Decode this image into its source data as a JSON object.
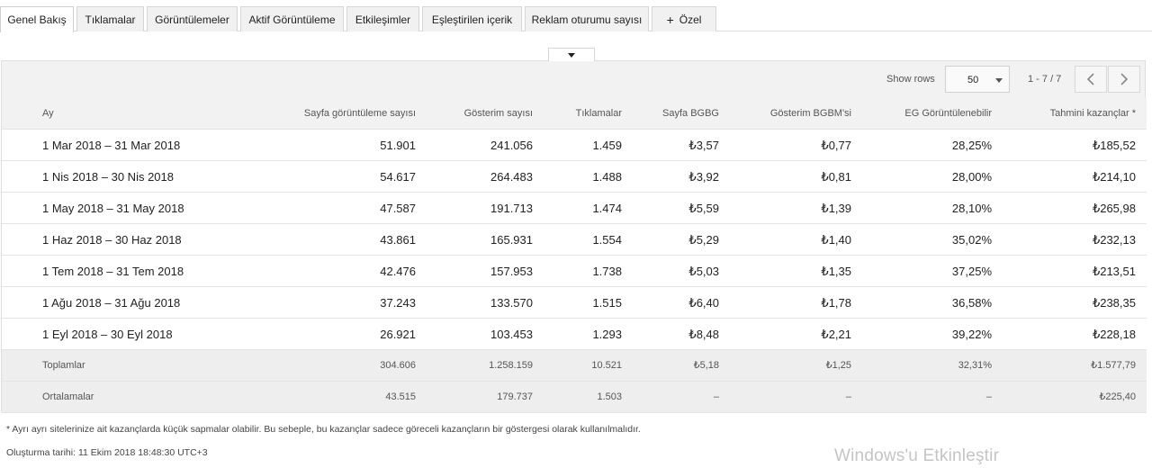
{
  "tabs": [
    {
      "label": "Genel Bakış",
      "active": true
    },
    {
      "label": "Tıklamalar"
    },
    {
      "label": "Görüntülemeler"
    },
    {
      "label": "Aktif Görüntüleme"
    },
    {
      "label": "Etkileşimler"
    },
    {
      "label": "Eşleştirilen içerik"
    },
    {
      "label": "Reklam oturumu sayısı"
    },
    {
      "label": "Özel",
      "icon": "plus-icon"
    }
  ],
  "toolbar": {
    "show_rows_label": "Show rows",
    "rows_value": "50",
    "page_info": "1 - 7 / 7"
  },
  "table": {
    "columns": [
      "Ay",
      "Sayfa görüntüleme sayısı",
      "Gösterim sayısı",
      "Tıklamalar",
      "Sayfa BGBG",
      "Gösterim BGBM'si",
      "EG Görüntülenebilir",
      "Tahmini kazançlar *"
    ],
    "rows": [
      [
        "1 Mar 2018 – 31 Mar 2018",
        "51.901",
        "241.056",
        "1.459",
        "₺3,57",
        "₺0,77",
        "28,25%",
        "₺185,52"
      ],
      [
        "1 Nis 2018 – 30 Nis 2018",
        "54.617",
        "264.483",
        "1.488",
        "₺3,92",
        "₺0,81",
        "28,00%",
        "₺214,10"
      ],
      [
        "1 May 2018 – 31 May 2018",
        "47.587",
        "191.713",
        "1.474",
        "₺5,59",
        "₺1,39",
        "28,10%",
        "₺265,98"
      ],
      [
        "1 Haz 2018 – 30 Haz 2018",
        "43.861",
        "165.931",
        "1.554",
        "₺5,29",
        "₺1,40",
        "35,02%",
        "₺232,13"
      ],
      [
        "1 Tem 2018 – 31 Tem 2018",
        "42.476",
        "157.953",
        "1.738",
        "₺5,03",
        "₺1,35",
        "37,25%",
        "₺213,51"
      ],
      [
        "1 Ağu 2018 – 31 Ağu 2018",
        "37.243",
        "133.570",
        "1.515",
        "₺6,40",
        "₺1,78",
        "36,58%",
        "₺238,35"
      ],
      [
        "1 Eyl 2018 – 30 Eyl 2018",
        "26.921",
        "103.453",
        "1.293",
        "₺8,48",
        "₺2,21",
        "39,22%",
        "₺228,18"
      ]
    ],
    "totals": [
      "Toplamlar",
      "304.606",
      "1.258.159",
      "10.521",
      "₺5,18",
      "₺1,25",
      "32,31%",
      "₺1.577,79"
    ],
    "averages": [
      "Ortalamalar",
      "43.515",
      "179.737",
      "1.503",
      "–",
      "–",
      "–",
      "₺225,40"
    ]
  },
  "footnote": "* Ayrı ayrı sitelerinize ait kazançlarda küçük sapmalar olabilir. Bu sebeple, bu kazançlar sadece göreceli kazançların bir göstergesi olarak kullanılmalıdır.",
  "created": "Oluşturma tarihi: 11 Ekim 2018 18:48:30 UTC+3",
  "watermark": "Windows'u Etkinleştir"
}
